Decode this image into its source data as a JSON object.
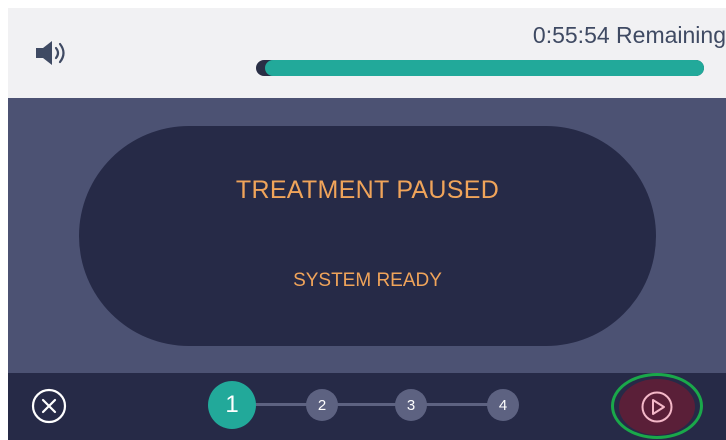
{
  "header": {
    "remaining_text": "0:55:54 Remaining",
    "progress_fraction": 0.98,
    "volume_icon": "speaker-volume-icon"
  },
  "status": {
    "title": "TREATMENT PAUSED",
    "subtitle": "SYSTEM READY"
  },
  "footer": {
    "cancel_icon": "close-circle-icon",
    "steps": [
      {
        "label": "1",
        "active": true
      },
      {
        "label": "2",
        "active": false
      },
      {
        "label": "3",
        "active": false
      },
      {
        "label": "4",
        "active": false
      }
    ],
    "play_icon": "play-circle-icon"
  },
  "colors": {
    "accent": "#22a99a",
    "status_text": "#f0a45a",
    "panel": "#262a47",
    "background": "#4c5273",
    "play_button": "#5a1f38",
    "highlight": "#1aa84a"
  }
}
